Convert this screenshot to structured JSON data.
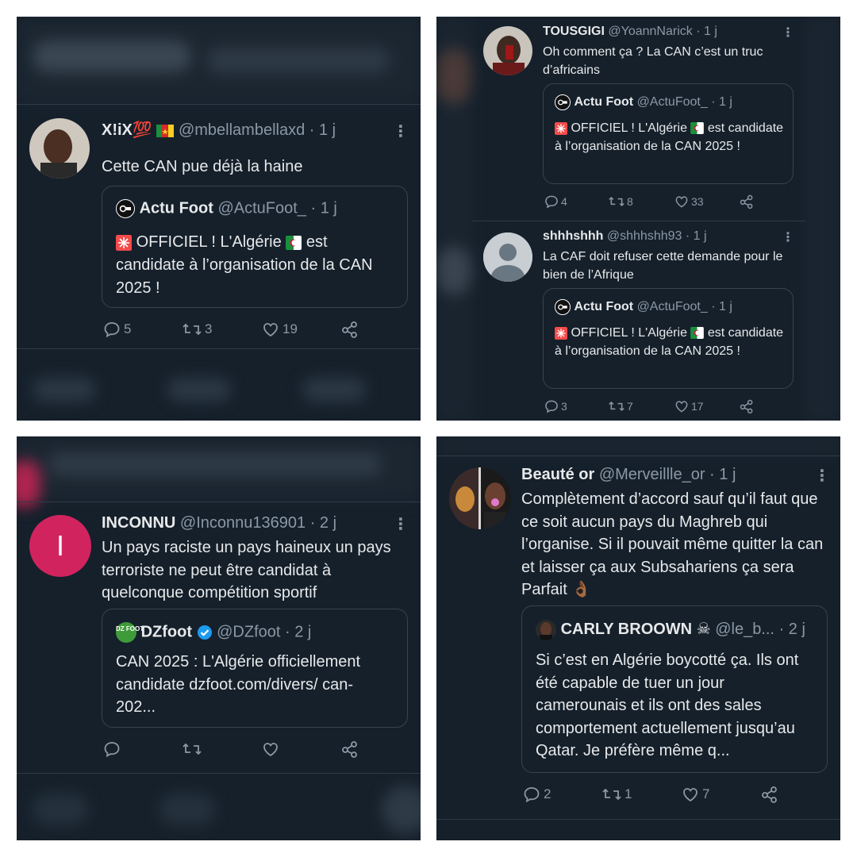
{
  "panels": [
    {
      "tweet": {
        "name": "X!iX💯",
        "handle": "@mbellambellaxd",
        "time": "1 j",
        "text": "Cette CAN pue déjà la haine",
        "quote": {
          "name": "Actu Foot",
          "handle": "@ActuFoot_",
          "time": "1 j",
          "text_a": "OFFICIEL ! L'Algérie",
          "text_b": "est candidate à l’organisation de la CAN 2025 !"
        },
        "replies": "5",
        "retweets": "3",
        "likes": "19"
      }
    },
    {
      "tweets": [
        {
          "name": "TOUSGIGI",
          "handle": "@YoannNarick",
          "time": "1 j",
          "text": "Oh comment ça ? La CAN c’est un truc d’africains",
          "quote": {
            "name": "Actu Foot",
            "handle": "@ActuFoot_",
            "time": "1 j",
            "text_a": "OFFICIEL ! L'Algérie",
            "text_b": "est candidate à l’organisation de la CAN 2025 !"
          },
          "replies": "4",
          "retweets": "8",
          "likes": "33"
        },
        {
          "name": "shhhshhh",
          "handle": "@shhhshh93",
          "time": "1 j",
          "text": "La CAF doit refuser cette demande pour le bien de l’Afrique",
          "quote": {
            "name": "Actu Foot",
            "handle": "@ActuFoot_",
            "time": "1 j",
            "text_a": "OFFICIEL ! L'Algérie",
            "text_b": "est candidate à l’organisation de la CAN 2025 !"
          },
          "replies": "3",
          "retweets": "7",
          "likes": "17"
        }
      ]
    },
    {
      "tweet": {
        "avatar_letter": "I",
        "name": "INCONNU",
        "handle": "@Inconnu136901",
        "time": "2 j",
        "text": "Un pays raciste un pays haineux un pays terroriste ne peut être candidat à quelconque compétition sportif",
        "quote": {
          "name": "DZfoot",
          "handle": "@DZfoot",
          "time": "2 j",
          "logo_text": "DZ FOOT",
          "text": "CAN 2025 : L'Algérie officiellement candidate dzfoot.com/divers/ can-202..."
        }
      }
    },
    {
      "tweet": {
        "name": "Beauté or",
        "handle": "@Merveillle_or",
        "time": "1 j",
        "text": "Complètement d’accord sauf qu’il faut que ce soit aucun pays du Maghreb qui l’organise. Si il pouvait même quitter la can et laisser ça aux Subsahariens ça sera Parfait 👌🏾",
        "quote": {
          "name": "CARLY BROOWN",
          "name_emoji": "☠",
          "handle": "@le_b...",
          "time": "2 j",
          "text": "Si c’est en Algérie boycotté ça. Ils ont été capable de tuer un jour camerounais et ils ont des sales comportement actuellement jusqu’au Qatar. Je préfère même q..."
        },
        "replies": "2",
        "retweets": "1",
        "likes": "7"
      }
    }
  ],
  "colors": {
    "background": "#15202b",
    "border": "#38444d",
    "muted": "#8b98a5",
    "text": "#e7e9ea",
    "verified": "#1d9bf0",
    "inconnu_avatar": "#d1245f"
  },
  "icons": [
    "reply-icon",
    "retweet-icon",
    "like-icon",
    "share-icon",
    "more-icon",
    "verified-icon",
    "siren-icon",
    "algeria-flag-icon",
    "cameroon-flag-icon"
  ]
}
